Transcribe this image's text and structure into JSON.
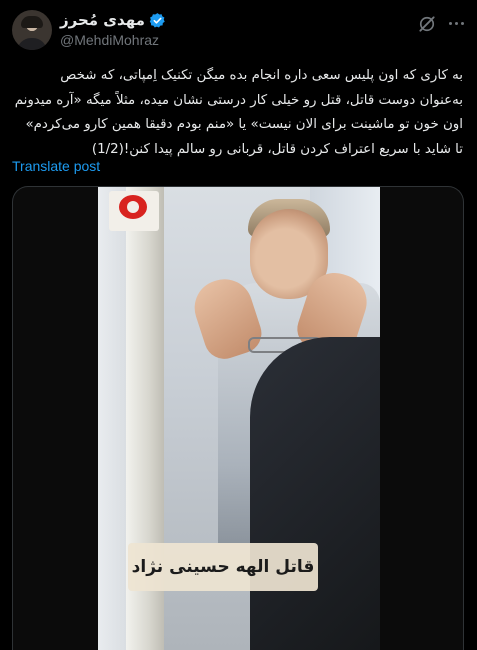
{
  "post": {
    "display_name": "مهدی مُحرز",
    "handle": "@MehdiMohraz",
    "text": "به کاری که اون پلیس سعی داره انجام بده میگن تکنیک اِمپاتی، که شخص به‌عنوان دوست قاتل، قتل رو خیلی کار درستی نشان میده، مثلاً میگه «آره میدونم اون خون تو ماشینت برای الان نیست» یا «منم بودم دقیقا همین کارو می‌کردم» تا شاید با سریع اعتراف کردن قاتل، قربانی رو سالم پیدا کنن!(1/2)",
    "translate_label": "Translate post"
  },
  "media": {
    "caption": "قاتل الهه حسینی نژاد"
  },
  "icons": {
    "verified": "verified-badge-icon",
    "grok": "grok-icon",
    "more": "more-options-icon"
  },
  "colors": {
    "background": "#000000",
    "accent": "#1d9bf0",
    "secondary_text": "#71767b"
  }
}
